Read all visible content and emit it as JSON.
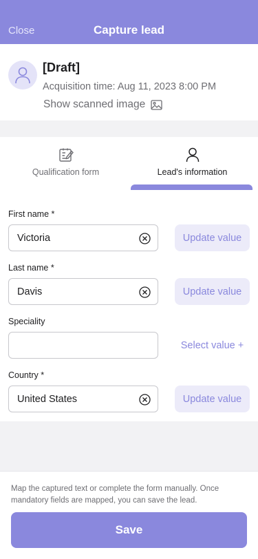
{
  "header": {
    "close_label": "Close",
    "title": "Capture lead",
    "color": "#8a88dd"
  },
  "lead": {
    "avatar_icon": "user-icon",
    "title": "[Draft]",
    "acquisition": "Acquisition time: Aug 11, 2023 8:00 PM",
    "scanned_link": "Show scanned image",
    "scanned_icon": "image-icon"
  },
  "tabs": [
    {
      "label": "Qualification form",
      "icon": "edit-form-icon",
      "active": false
    },
    {
      "label": "Lead's information",
      "icon": "person-icon",
      "active": true
    }
  ],
  "form": {
    "fields": [
      {
        "label": "First name *",
        "value": "Victoria",
        "action": "Update value"
      },
      {
        "label": "Last name *",
        "value": "Davis",
        "action": "Update value"
      },
      {
        "label": "Speciality",
        "value": "",
        "action": "Select value +"
      },
      {
        "label": "Country *",
        "value": "United States",
        "action": "Update value"
      }
    ]
  },
  "footer": {
    "help_text": "Map the captured text or complete the form manually. Once mandatory fields are mapped, you can save the lead.",
    "save_label": "Save"
  }
}
